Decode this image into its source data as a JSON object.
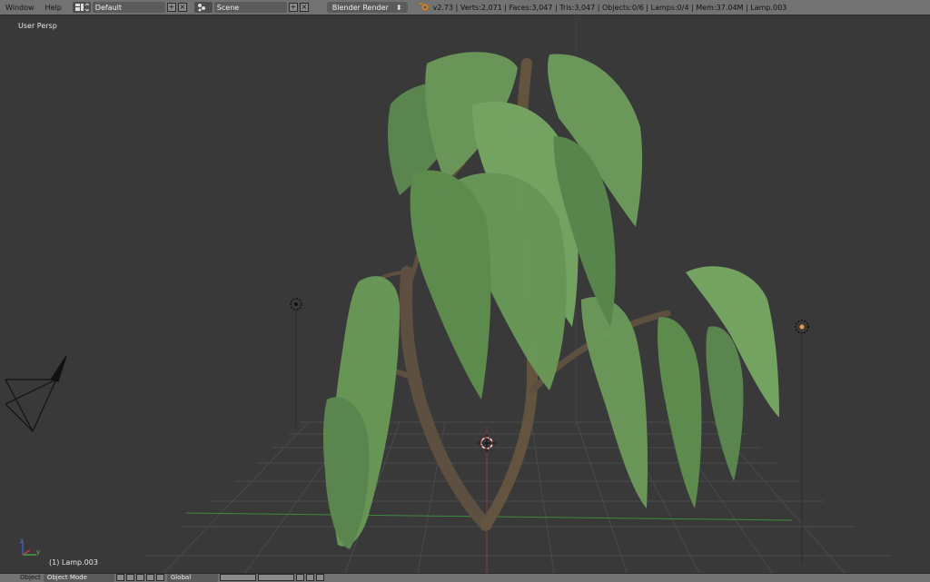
{
  "header": {
    "menus": [
      "Window",
      "Help"
    ],
    "screen_layout": "Default",
    "scene": "Scene",
    "render_engine": "Blender Render",
    "stats": "v2.73 | Verts:2,071 | Faces:3,047 | Tris:3,047 | Objects:0/6 | Lamps:0/4 | Mem:37.04M | Lamp.003"
  },
  "viewport": {
    "view_name": "User Persp",
    "active_object": "(1) Lamp.003",
    "axis_x": "x",
    "axis_y": "y"
  },
  "footer": {
    "view_label": "Object",
    "mode": "Object Mode",
    "orientation": "Global"
  },
  "colors": {
    "background": "#393939",
    "header": "#727272",
    "grid": "#4a4a4a",
    "x_axis": "#a33a3a",
    "y_axis": "#3f8a3f",
    "foliage": "#6a9a58",
    "trunk": "#6a5a4a"
  }
}
